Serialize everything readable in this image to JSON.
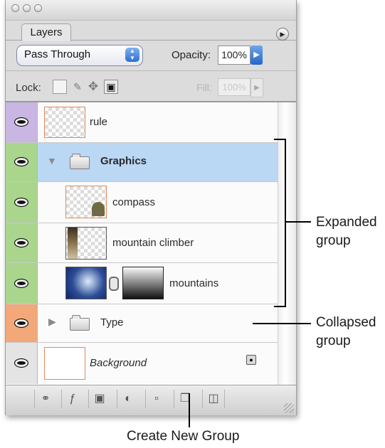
{
  "panel": {
    "tab_label": "Layers",
    "blend_mode": "Pass Through",
    "opacity_label": "Opacity:",
    "opacity_value": "100%",
    "lock_label": "Lock:",
    "fill_label": "Fill:",
    "fill_value": "100%"
  },
  "layers": [
    {
      "name": "rule",
      "eye_color": "#c9b6e2",
      "thumb": "transparent",
      "italic": false
    },
    {
      "name": "Graphics",
      "eye_color": "#a9d58d",
      "group": true,
      "expanded": true,
      "selected": true
    },
    {
      "name": "compass",
      "eye_color": "#a9d58d",
      "thumb": "compass",
      "indent": true
    },
    {
      "name": "mountain climber",
      "eye_color": "#a9d58d",
      "thumb": "climber",
      "indent": true
    },
    {
      "name": "mountains",
      "eye_color": "#a9d58d",
      "thumb": "mountains",
      "mask": true,
      "indent": true
    },
    {
      "name": "Type",
      "eye_color": "#f2a878",
      "group": true,
      "expanded": false
    },
    {
      "name": "Background",
      "eye_color": "#e4e4e4",
      "thumb": "white",
      "italic": true,
      "locked": true
    }
  ],
  "toolbar_icons": [
    "link-icon",
    "layer-style-icon",
    "add-mask-icon",
    "adjustment-layer-icon",
    "new-group-icon",
    "new-layer-icon",
    "trash-icon"
  ],
  "callouts": {
    "expanded": "Expanded\ngroup",
    "collapsed": "Collapsed\ngroup",
    "new_group": "Create New Group"
  }
}
